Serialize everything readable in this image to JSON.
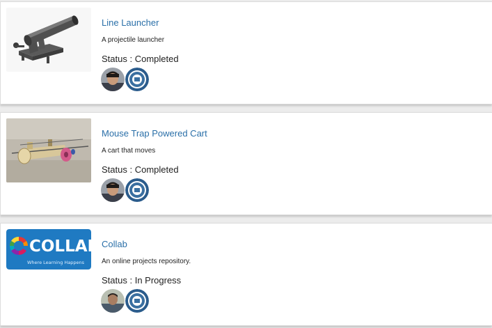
{
  "projects": [
    {
      "title": "Line Launcher",
      "description": "A projectile launcher",
      "status_label": "Status : ",
      "status": "Completed",
      "thumbnail": "cannon-launcher-image",
      "avatars": [
        "student-avatar",
        "school-seal-avatar"
      ]
    },
    {
      "title": "Mouse Trap Powered Cart",
      "description": "A cart that moves",
      "status_label": "Status : ",
      "status": "Completed",
      "thumbnail": "mousetrap-cart-photo",
      "avatars": [
        "student-avatar",
        "school-seal-avatar"
      ]
    },
    {
      "title": "Collab",
      "description": "An online projects repository.",
      "status_label": "Status : ",
      "status": "In Progress",
      "thumbnail": "collab-logo",
      "logo_text": "COLLAB",
      "logo_tagline": "Where Learning Happens",
      "avatars": [
        "student-avatar",
        "school-seal-avatar"
      ]
    }
  ],
  "colors": {
    "link": "#2a6fa8",
    "text": "#222222",
    "card_bg": "#ffffff",
    "page_bg": "#ececec",
    "collab_bg": "#1f7ac2"
  }
}
